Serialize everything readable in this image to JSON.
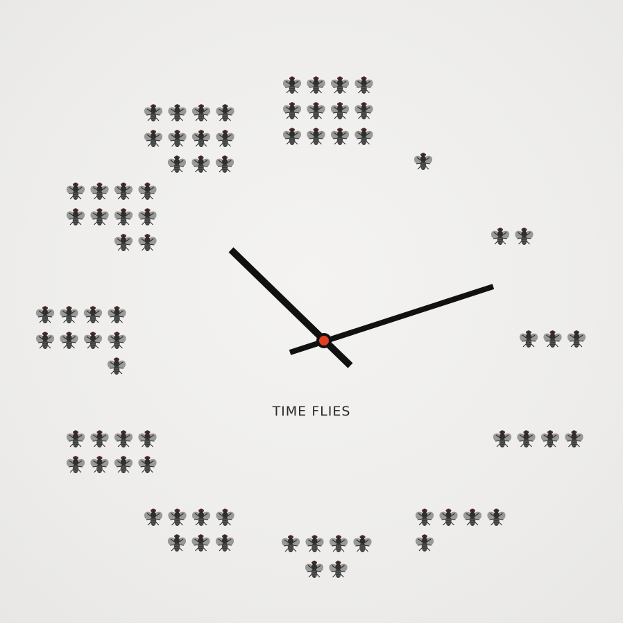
{
  "brand": {
    "text": "TIME FLIES"
  },
  "clock": {
    "hour_marker_icon": "fly-icon",
    "flies_per_hour": [
      {
        "hour": 1,
        "count": 1
      },
      {
        "hour": 2,
        "count": 2
      },
      {
        "hour": 3,
        "count": 3
      },
      {
        "hour": 4,
        "count": 4
      },
      {
        "hour": 5,
        "count": 5
      },
      {
        "hour": 6,
        "count": 6
      },
      {
        "hour": 7,
        "count": 7
      },
      {
        "hour": 8,
        "count": 8
      },
      {
        "hour": 9,
        "count": 9
      },
      {
        "hour": 10,
        "count": 10
      },
      {
        "hour": 11,
        "count": 11
      },
      {
        "hour": 12,
        "count": 12
      }
    ],
    "hand_color": "#111111",
    "center_cap_color": "#e0401e",
    "fly_color": "#3a3a3a"
  }
}
